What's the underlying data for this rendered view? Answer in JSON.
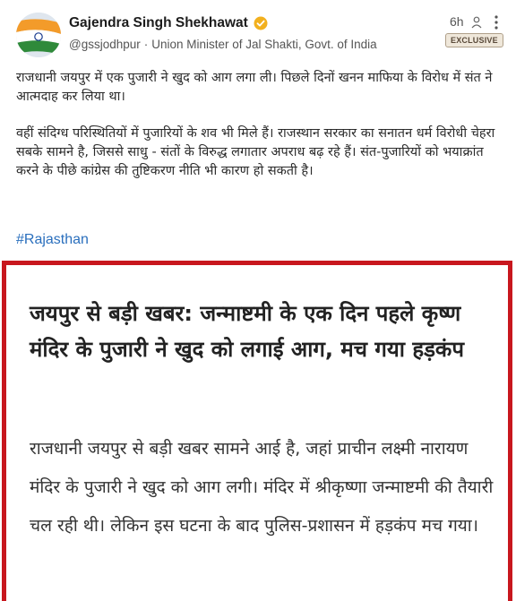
{
  "post": {
    "author_name": "Gajendra Singh Shekhawat",
    "handle": "@gssjodhpur",
    "role": "Union Minister of Jal Shakti, Govt. of India",
    "time": "6h",
    "badge": "EXCLUSIVE",
    "paragraphs": [
      "राजधानी जयपुर में एक पुजारी ने खुद को आग लगा ली। पिछले दिनों खनन माफिया के विरोध में संत ने आत्मदाह कर लिया था।",
      "वहीं संदिग्ध परिस्थितियों में पुजारियों के शव भी मिले हैं। राजस्थान सरकार का सनातन धर्म विरोधी चेहरा सबके सामने है, जिससे साधु - संतों के विरुद्ध लगातार अपराध बढ़ रहे हैं। संत-पुजारियों को भयाक्रांत करने के पीछे कांग्रेस की तुष्टिकरण नीति भी कारण हो सकती है।"
    ],
    "hashtag": "#Rajasthan"
  },
  "card": {
    "headline": "जयपुर से बड़ी खबर: जन्माष्टमी के एक दिन पहले कृष्ण मंदिर के पुजारी ने खुद को लगाई आग, मच गया हड़कंप",
    "body": "राजधानी जयपुर से बड़ी खबर सामने आई है, जहां प्राचीन लक्ष्मी नारायण मंदिर के पुजारी ने खुद को आग लगी। मंदिर में श्रीकृष्णा जन्माष्टमी की तैयारी चल रही थी। लेकिन इस घटना के बाद पुलिस-प्रशासन में हड़कंप मच गया।",
    "border_color": "#c8171e"
  },
  "icons": {
    "avatar": "indian-flag",
    "verified": "verified-check-icon",
    "follow": "person-icon",
    "menu": "more-vertical-icon"
  }
}
